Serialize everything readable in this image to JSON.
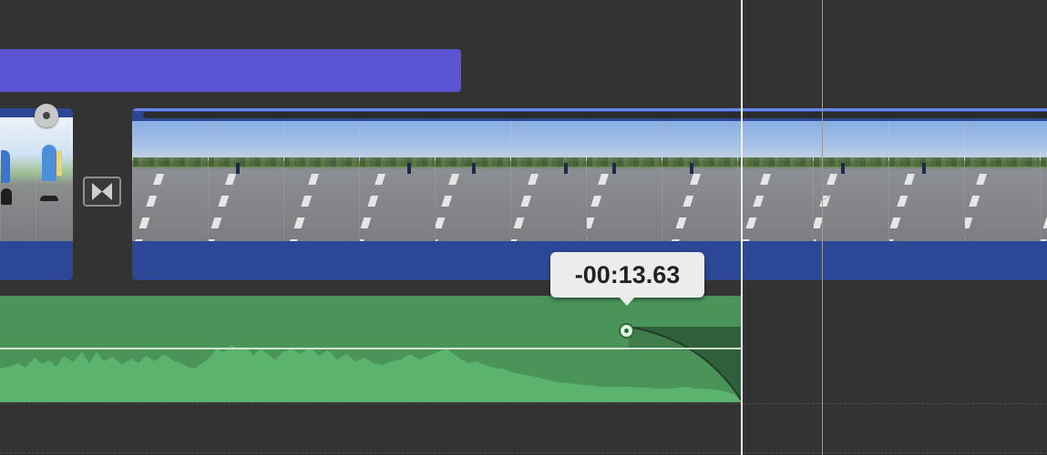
{
  "timeline": {
    "title_clip": {
      "color": "#5a53d2"
    },
    "video_clip_color": "#2c4796",
    "audio_clip_color": "#4a9359",
    "transition": {
      "icon": "bowtie-transition-icon"
    },
    "fade_tooltip": {
      "time": "-00:13.63"
    }
  }
}
